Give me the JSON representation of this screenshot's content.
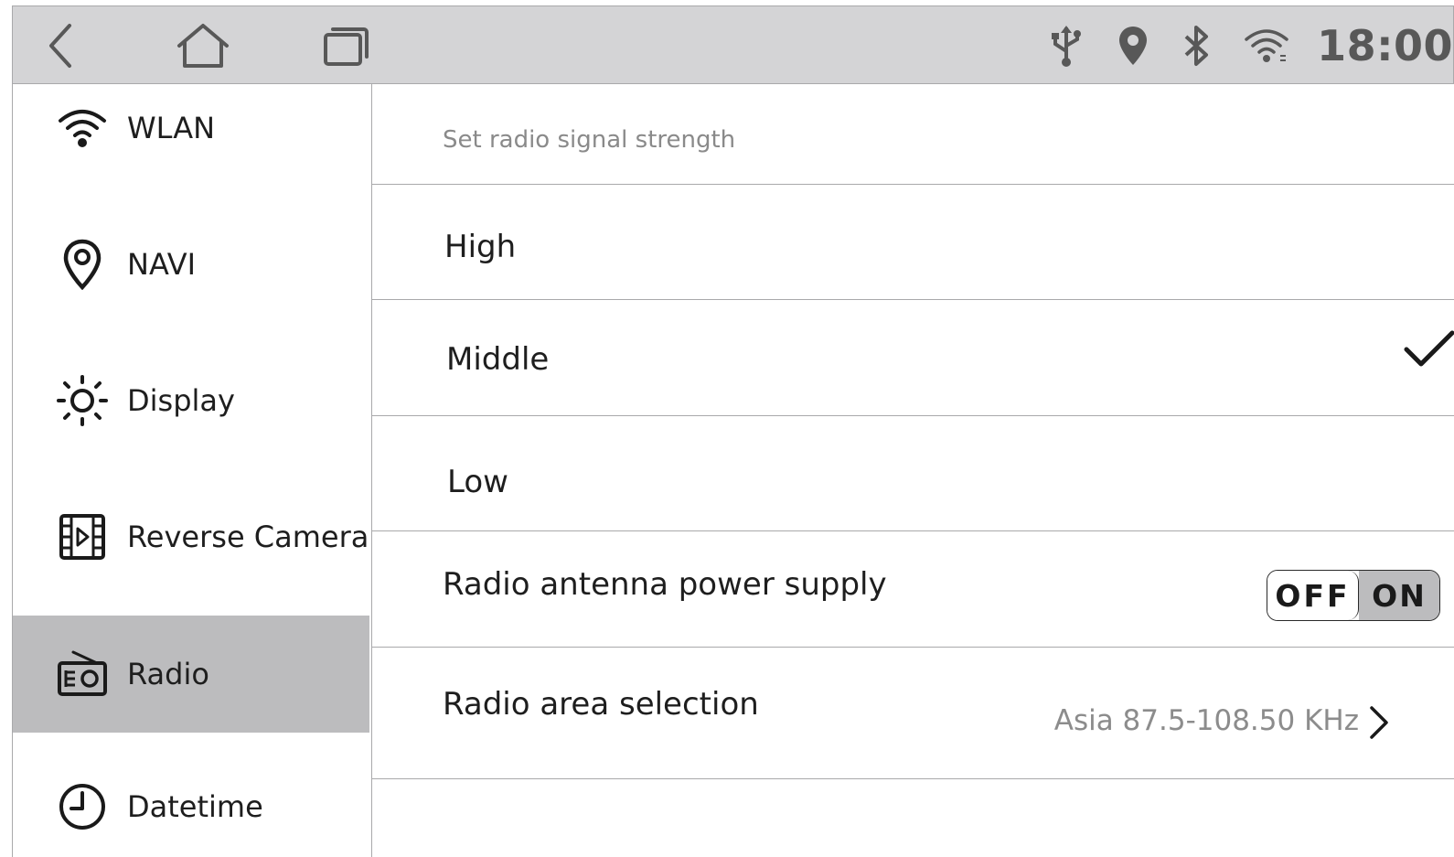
{
  "status_bar": {
    "clock": "18:00",
    "nav_icons": [
      "back-icon",
      "home-icon",
      "recent-apps-icon"
    ],
    "status_icons": [
      "usb-icon",
      "location-icon",
      "bluetooth-icon",
      "wifi-icon"
    ]
  },
  "sidebar": {
    "items": [
      {
        "label": "WLAN",
        "icon": "wifi-icon",
        "active": false
      },
      {
        "label": "NAVI",
        "icon": "location-pin-icon",
        "active": false
      },
      {
        "label": "Display",
        "icon": "sun-icon",
        "active": false
      },
      {
        "label": "Reverse Camera",
        "icon": "film-camera-icon",
        "active": false
      },
      {
        "label": "Radio",
        "icon": "radio-icon",
        "active": true
      },
      {
        "label": "Datetime",
        "icon": "clock-icon",
        "active": false
      }
    ]
  },
  "content": {
    "hint": "Set radio signal strength",
    "options": [
      {
        "label": "High",
        "selected": false
      },
      {
        "label": "Middle",
        "selected": true
      },
      {
        "label": "Low",
        "selected": false
      }
    ],
    "antenna": {
      "label": "Radio antenna power supply",
      "off_label": "OFF",
      "on_label": "ON",
      "state": "OFF"
    },
    "area": {
      "label": "Radio area selection",
      "value": "Asia 87.5-108.50 KHz"
    }
  },
  "colors": {
    "status_bar_bg": "#d4d4d6",
    "active_item_bg": "#bcbcbe",
    "divider": "#a9a9ab",
    "status_icon": "#585858"
  }
}
